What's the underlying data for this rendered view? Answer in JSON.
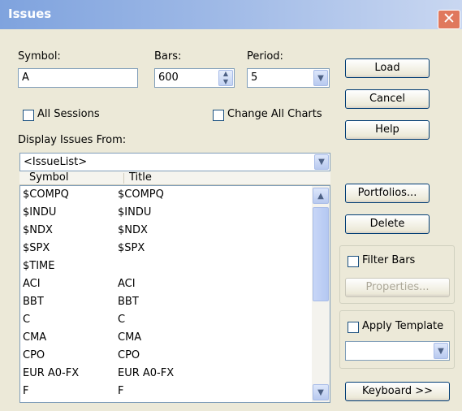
{
  "window": {
    "title": "Issues",
    "close": "✕"
  },
  "symbol": {
    "label": "Symbol:",
    "value": "A"
  },
  "bars": {
    "label": "Bars:",
    "value": "600"
  },
  "period": {
    "label": "Period:",
    "value": "5"
  },
  "all_sessions": {
    "label": "All Sessions",
    "checked": false
  },
  "change_all_charts": {
    "label": "Change All Charts",
    "checked": false
  },
  "display_from": {
    "label": "Display Issues From:",
    "value": "<IssueList>"
  },
  "list": {
    "columns": [
      "Symbol",
      "Title"
    ],
    "rows": [
      [
        "$COMPQ",
        "$COMPQ"
      ],
      [
        "$INDU",
        "$INDU"
      ],
      [
        "$NDX",
        "$NDX"
      ],
      [
        "$SPX",
        "$SPX"
      ],
      [
        "$TIME",
        ""
      ],
      [
        "ACI",
        "ACI"
      ],
      [
        "BBT",
        "BBT"
      ],
      [
        "C",
        "C"
      ],
      [
        "CMA",
        "CMA"
      ],
      [
        "CPO",
        "CPO"
      ],
      [
        "EUR A0-FX",
        "EUR A0-FX"
      ],
      [
        "F",
        "F"
      ]
    ]
  },
  "buttons": {
    "load": "Load",
    "cancel": "Cancel",
    "help": "Help",
    "portfolios": "Portfolios...",
    "delete": "Delete",
    "properties": "Properties...",
    "keyboard": "Keyboard >>"
  },
  "filter_bars": {
    "label": "Filter Bars",
    "checked": false
  },
  "apply_template": {
    "label": "Apply Template",
    "checked": false,
    "value": ""
  },
  "icons": {
    "dropdown": "▼",
    "spin_up": "▲",
    "spin_down": "▼",
    "scroll_up": "▲",
    "scroll_down": "▼"
  }
}
